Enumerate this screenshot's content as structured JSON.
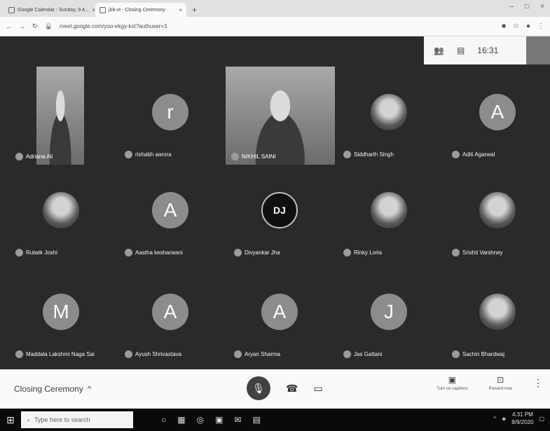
{
  "browser": {
    "tabs": [
      {
        "label": "Google Calendar - Sunday, 9 A...",
        "active": false
      },
      {
        "label": "jbb-vt - Closing Ceremony",
        "active": true
      }
    ],
    "new_tab": "+",
    "url": "meet.google.com/yoo-ekgy-kst?authuser=3",
    "window_controls": [
      "–",
      "□",
      "×"
    ]
  },
  "meet": {
    "time": "16:31",
    "top_icons": [
      "people-icon",
      "chat-icon"
    ],
    "participants": [
      {
        "name": "Adriana Ali",
        "kind": "video"
      },
      {
        "name": "rishabh aarora",
        "kind": "avatar",
        "letter": "r"
      },
      {
        "name": "NIKHIL SAINI",
        "kind": "video"
      },
      {
        "name": "Siddharth Singh",
        "kind": "photo"
      },
      {
        "name": "Aditi Agarwal",
        "kind": "avatar",
        "letter": "A"
      },
      {
        "name": "Rutwik Joshi",
        "kind": "photo"
      },
      {
        "name": "Aastha kesharwani",
        "kind": "avatar",
        "letter": "A"
      },
      {
        "name": "Divyankar Jha",
        "kind": "logo",
        "letter": "DJ"
      },
      {
        "name": "Rinky Loria",
        "kind": "photo"
      },
      {
        "name": "Srishti Varshney",
        "kind": "photo"
      },
      {
        "name": "Maddala Lakshmi Naga Sai",
        "kind": "avatar",
        "letter": "M"
      },
      {
        "name": "Ayush Shrivastava",
        "kind": "avatar",
        "letter": "A"
      },
      {
        "name": "Aryan Sharma",
        "kind": "avatar",
        "letter": "A"
      },
      {
        "name": "Jas Gattani",
        "kind": "avatar",
        "letter": "J"
      },
      {
        "name": "Sachin Bhardwaj",
        "kind": "photo"
      }
    ],
    "meeting_title": "Closing Ceremony",
    "meeting_chevron": "^",
    "captions_label": "Turn on captions",
    "present_label": "Present now",
    "more": "⋮"
  },
  "taskbar": {
    "search_placeholder": "Type here to search",
    "time": "4:31 PM",
    "date": "8/9/2020"
  }
}
